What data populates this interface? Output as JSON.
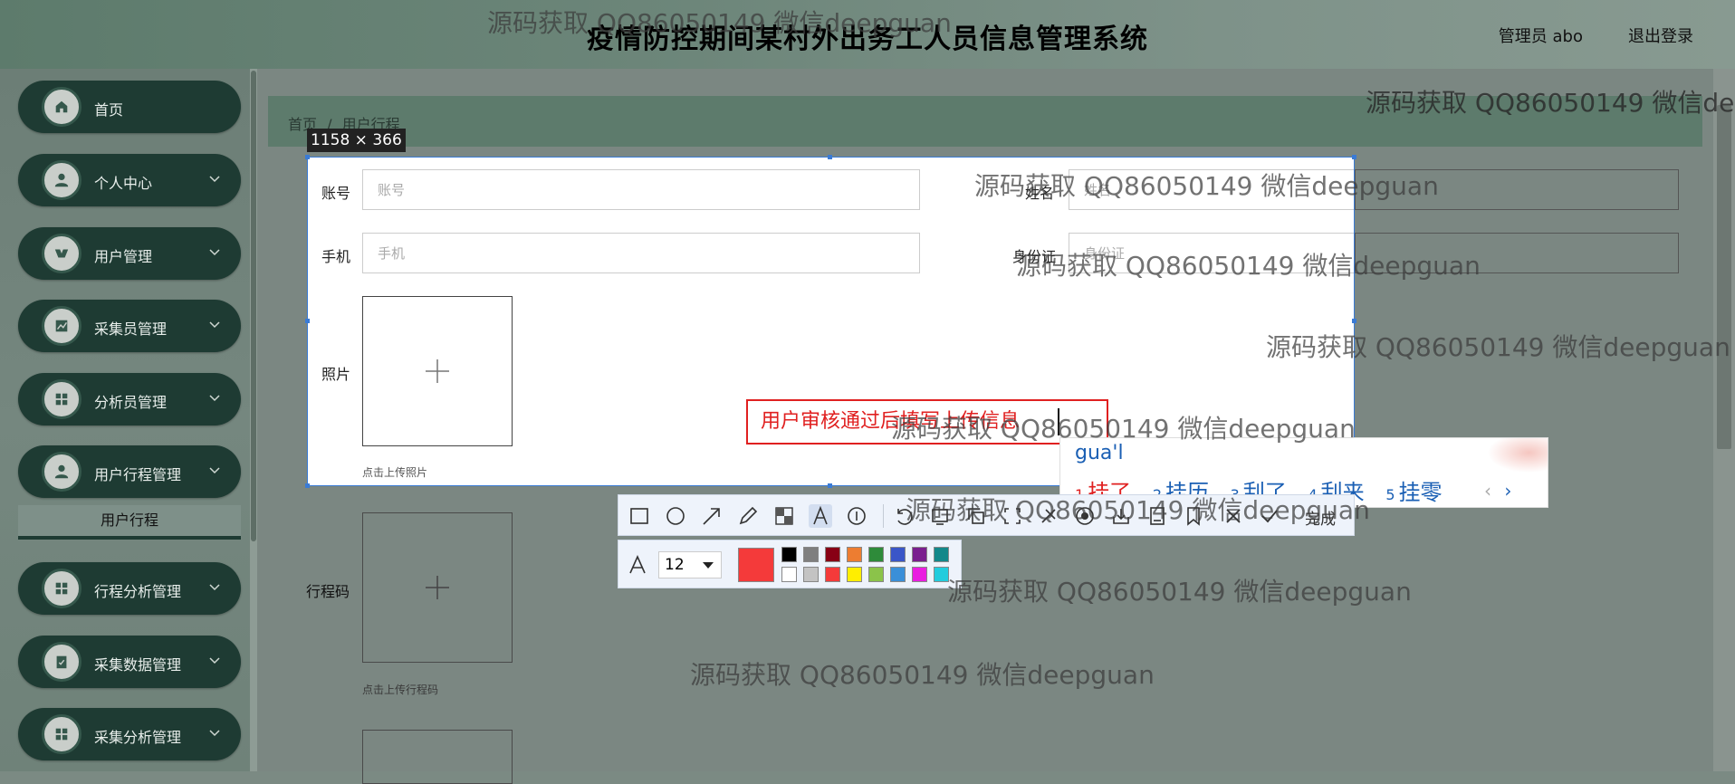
{
  "header": {
    "title": "疫情防控期间某村外出务工人员信息管理系统",
    "user": "管理员 abo",
    "logout": "退出登录"
  },
  "sidebar": {
    "items": [
      {
        "label": "首页",
        "icon": "home-icon"
      },
      {
        "label": "个人中心",
        "icon": "person-icon"
      },
      {
        "label": "用户管理",
        "icon": "users-icon"
      },
      {
        "label": "采集员管理",
        "icon": "chart-icon"
      },
      {
        "label": "分析员管理",
        "icon": "grid-icon"
      },
      {
        "label": "用户行程管理",
        "icon": "person-icon"
      },
      {
        "label": "行程分析管理",
        "icon": "grid-icon"
      },
      {
        "label": "采集数据管理",
        "icon": "clipboard-icon"
      },
      {
        "label": "采集分析管理",
        "icon": "grid-icon"
      }
    ],
    "active_sub": "用户行程"
  },
  "breadcrumb": {
    "home": "首页",
    "sep": "/",
    "current": "用户行程"
  },
  "form": {
    "account_label": "账号",
    "account_placeholder": "账号",
    "name_label": "姓名",
    "name_placeholder": "姓名",
    "phone_label": "手机",
    "phone_placeholder": "手机",
    "id_label": "身份证",
    "id_placeholder": "身份证",
    "photo_label": "照片",
    "photo_hint": "点击上传照片",
    "trip_code_label": "行程码",
    "trip_code_hint": "点击上传行程码"
  },
  "screenshot_tool": {
    "size_label": "1158 × 366",
    "annotation_text": "用户审核通过后填写上传信息",
    "done_label": "完成",
    "font_size": "12",
    "current_color": "#f43a3a",
    "palette_top": [
      "#000000",
      "#7f7f7f",
      "#880015",
      "#ed7d31",
      "#2e8b3a",
      "#3a56c8",
      "#7a1f8f",
      "#13888a"
    ],
    "palette_bottom": [
      "#ffffff",
      "#c3c3c3",
      "#f43a3a",
      "#ffee00",
      "#8bc34a",
      "#3a8fd8",
      "#e91ee0",
      "#22ccdd"
    ]
  },
  "ime": {
    "composition": "gua'l",
    "candidates": [
      {
        "num": "1",
        "text": "挂了"
      },
      {
        "num": "2",
        "text": "挂历"
      },
      {
        "num": "3",
        "text": "刮了"
      },
      {
        "num": "4",
        "text": "刮来"
      },
      {
        "num": "5",
        "text": "挂零"
      }
    ],
    "prev": "‹",
    "next": "›"
  },
  "watermark": "源码获取 QQ86050149 微信deepguan"
}
